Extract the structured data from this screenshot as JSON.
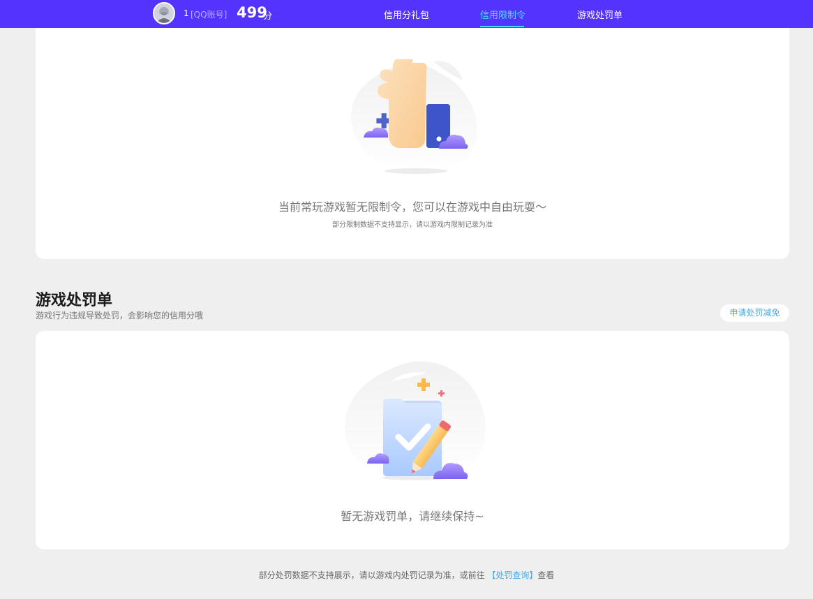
{
  "header": {
    "user_id": "1",
    "account_type": "[QQ账号]",
    "score": "499",
    "score_unit": "分",
    "nav": [
      {
        "label": "信用分礼包",
        "active": false
      },
      {
        "label": "信用限制令",
        "active": true
      },
      {
        "label": "游戏处罚单",
        "active": false
      }
    ]
  },
  "restriction": {
    "empty_message": "当前常玩游戏暂无限制令，您可以在游戏中自由玩耍～",
    "note": "部分限制数据不支持显示，请以游戏内限制记录为准"
  },
  "penalty": {
    "title": "游戏处罚单",
    "description": "游戏行为违规导致处罚，会影响您的信用分哦",
    "apply_button": "申请处罚减免",
    "empty_message": "暂无游戏罚单，请继续保持~"
  },
  "footer": {
    "note_prefix": "部分处罚数据不支持展示，请以游戏内处罚记录为准，或前往",
    "link_label": "【处罚查询】",
    "note_suffix": "查看"
  },
  "icons": {
    "avatar": "avatar",
    "thumbs_up": "thumbs-up-illustration-icon",
    "checklist": "checklist-illustration-icon"
  },
  "colors": {
    "nav_bg": "#5533ff",
    "nav_active": "#4fd8ff",
    "link": "#3fa9e8"
  }
}
